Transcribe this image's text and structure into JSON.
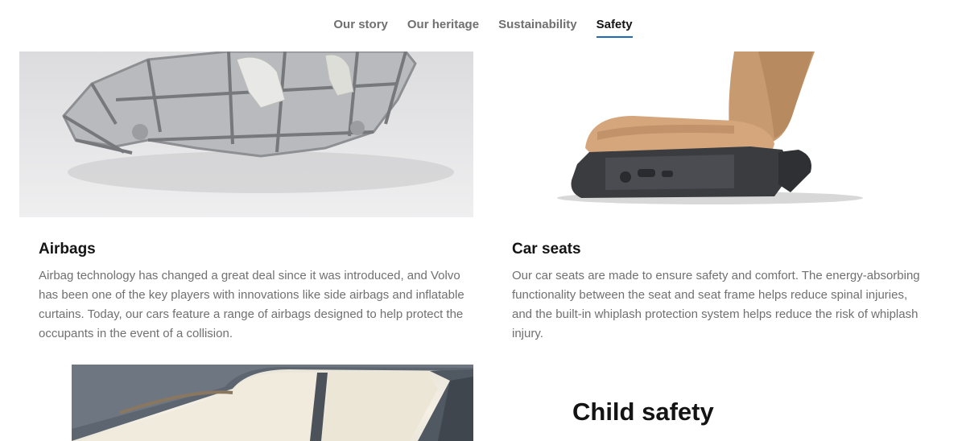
{
  "nav": {
    "tabs": [
      {
        "label": "Our story"
      },
      {
        "label": "Our heritage"
      },
      {
        "label": "Sustainability"
      },
      {
        "label": "Safety"
      }
    ],
    "active_tab": "Safety",
    "accent_color": "#1c6bba"
  },
  "cards": [
    {
      "title": "Airbags",
      "image_icon": "car-body-frame-image",
      "text": "Airbag technology has changed a great deal since it was introduced, and Volvo has been one of the key players with innovations like side airbags and inflatable curtains. Today, our cars feature a range of airbags designed to help protect the occupants in the event of a collision."
    },
    {
      "title": "Car seats",
      "image_icon": "car-seat-image",
      "text": "Our car seats are made to ensure safety and comfort. The energy-absorbing functionality between the seat and seat frame helps reduce spinal injuries, and the built-in whiplash protection system helps reduce the risk of whiplash injury."
    }
  ],
  "child_safety": {
    "title": "Child safety",
    "image_icon": "car-door-image"
  }
}
